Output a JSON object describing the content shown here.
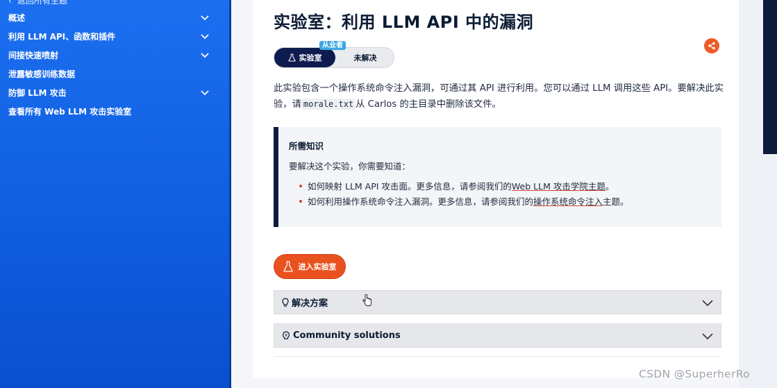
{
  "sidebar": {
    "back_label": "返回所有主题",
    "items": [
      {
        "label": "概述",
        "expandable": true
      },
      {
        "label": "利用 LLM API、函数和插件",
        "expandable": true
      },
      {
        "label": "间接快速喷射",
        "expandable": true
      },
      {
        "label": "泄露敏感训练数据",
        "expandable": false
      },
      {
        "label": "防御 LLM 攻击",
        "expandable": true
      },
      {
        "label": "查看所有 Web LLM 攻击实验室",
        "expandable": false
      }
    ]
  },
  "main": {
    "title": "实验室：利用 LLM API 中的漏洞",
    "level_badge": "从业者",
    "lab_pill": "实验室",
    "status_pill": "未解决",
    "description_part1": "此实验包含一个操作系统命令注入漏洞，可通过其 API 进行利用。您可以通过 LLM 调用这些 API。要解决此实验，请",
    "description_code": "morale.txt",
    "description_part2": "从 Carlos 的主目录中删除该文件。",
    "knowledge": {
      "title": "所需知识",
      "intro": "要解决这个实验，你需要知道：",
      "bullet1_text": "如何映射 LLM API 攻击面。更多信息，请参阅我们的",
      "bullet1_link": "Web LLM 攻击学院主题",
      "bullet1_end": "。",
      "bullet2_text": "如何利用操作系统命令注入漏洞。更多信息，请参阅我们的",
      "bullet2_link": "操作系统命令注入",
      "bullet2_end": "主题。"
    },
    "access_button": "进入实验室",
    "solution_label": "解决方案",
    "community_label": "Community solutions"
  },
  "watermark": "CSDN @SuperherRo",
  "colors": {
    "sidebar": "#1566e8",
    "accent_orange": "#e9521f",
    "navy": "#0d1b3d",
    "badge_blue": "#3aa7e3"
  },
  "icons": [
    "chevron-left-icon",
    "chevron-down-icon",
    "flask-icon",
    "share-icon",
    "lightbulb-icon",
    "community-icon",
    "pointer-cursor-icon"
  ]
}
